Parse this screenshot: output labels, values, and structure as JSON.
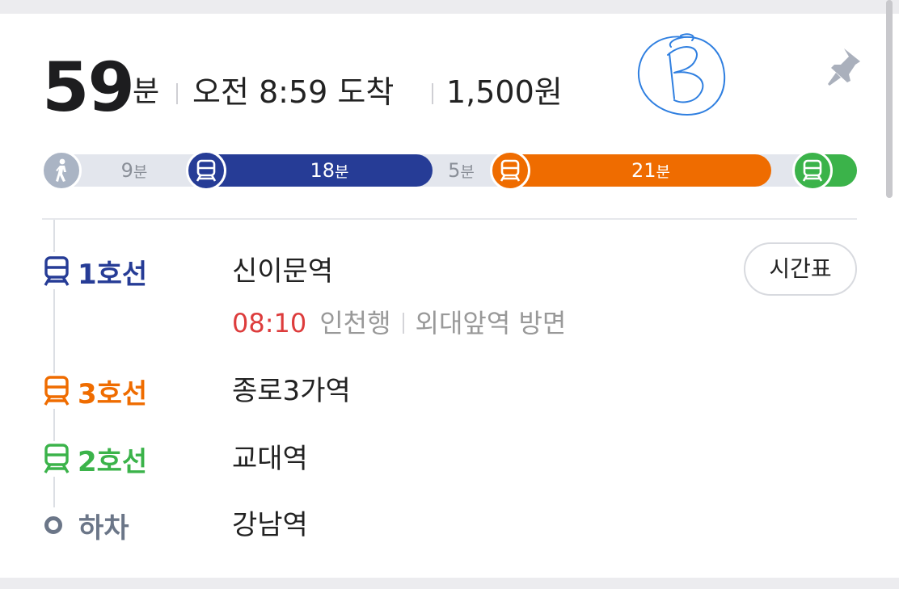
{
  "summary": {
    "duration_value": "59",
    "duration_unit": "분",
    "arrival": "오전 8:59 도착",
    "fare": "1,500원"
  },
  "segments": [
    {
      "mode": "walk",
      "icon": "walking-person-icon",
      "num": "9",
      "unit": "분",
      "color": "#aab4c4"
    },
    {
      "mode": "subway",
      "icon": "subway-train-icon",
      "num": "18",
      "unit": "분",
      "color": "#263c96"
    },
    {
      "mode": "walk",
      "num": "5",
      "unit": "분"
    },
    {
      "mode": "subway",
      "icon": "subway-train-icon",
      "num": "21",
      "unit": "분",
      "color": "#ef6c00"
    },
    {
      "mode": "subway",
      "icon": "subway-train-icon",
      "num": "",
      "unit": "",
      "color": "#3bb34a"
    }
  ],
  "route": {
    "steps": [
      {
        "line": "1호선",
        "station": "신이문역",
        "color": "#263c96",
        "icon": "subway-train-icon"
      },
      {
        "line": "3호선",
        "station": "종로3가역",
        "color": "#ef6c00",
        "icon": "subway-train-icon"
      },
      {
        "line": "2호선",
        "station": "교대역",
        "color": "#3bb34a",
        "icon": "subway-train-icon"
      },
      {
        "line": "하차",
        "station": "강남역",
        "color": "#6b7688",
        "icon": "alight-circle-icon"
      }
    ],
    "first_departure": {
      "time": "08:10",
      "destination": "인천행",
      "direction": "외대앞역 방면"
    },
    "timetable_button": "시간표"
  },
  "colors": {
    "line1": "#263c96",
    "line3": "#ef6c00",
    "line2": "#3bb34a",
    "time_red": "#dd3c3c",
    "walk_gray": "#aab4c4"
  }
}
